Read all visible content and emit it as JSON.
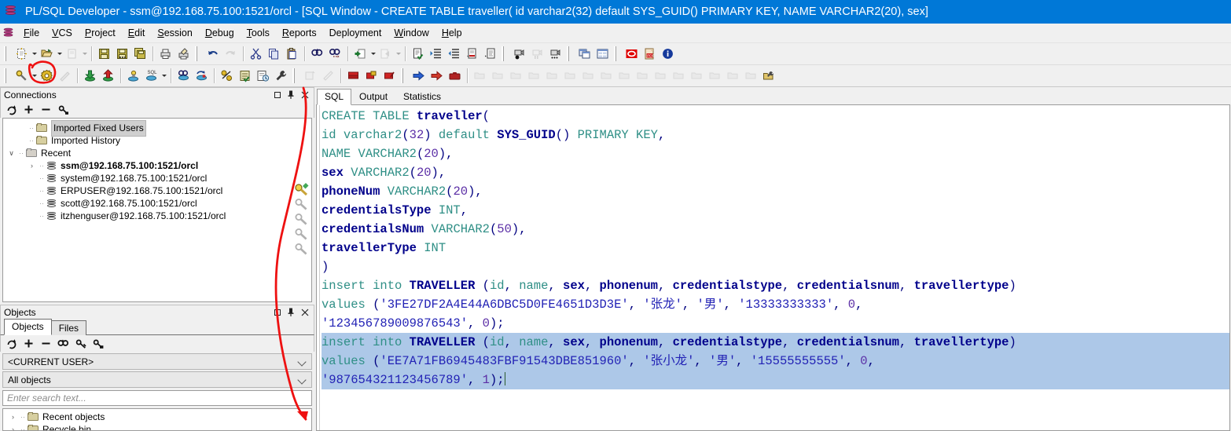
{
  "window": {
    "title": "PL/SQL Developer - ssm@192.168.75.100:1521/orcl - [SQL Window - CREATE TABLE traveller( id varchar2(32) default SYS_GUID() PRIMARY KEY, NAME VARCHAR2(20), sex]",
    "app_icon": "database-icon"
  },
  "menubar": {
    "items": [
      {
        "label": "File",
        "accel": "F"
      },
      {
        "label": "VCS",
        "accel": "V"
      },
      {
        "label": "Project",
        "accel": "P"
      },
      {
        "label": "Edit",
        "accel": "E"
      },
      {
        "label": "Session",
        "accel": "S"
      },
      {
        "label": "Debug",
        "accel": "D"
      },
      {
        "label": "Tools",
        "accel": "T"
      },
      {
        "label": "Reports",
        "accel": "R"
      },
      {
        "label": "Deployment",
        "accel": ""
      },
      {
        "label": "Window",
        "accel": "W"
      },
      {
        "label": "Help",
        "accel": "H"
      }
    ]
  },
  "toolbar_row1": {
    "items": [
      "new-document-icon",
      "new-dropdown",
      "open-folder-icon",
      "open-dropdown",
      "print-preview-icon",
      "print-dropdown",
      "save-icon",
      "save-as-icon",
      "save-all-icon",
      "print-icon",
      "print-setup-icon",
      "undo-icon",
      "redo-icon",
      "cut-icon",
      "copy-icon",
      "paste-icon",
      "find-icon",
      "find-next-icon",
      "previous-window-icon",
      "window-list-dropdown",
      "next-window-icon",
      "next-dropdown",
      "syntax-check-icon",
      "indent-icon",
      "outdent-icon",
      "comment-icon",
      "uncomment-icon",
      "record-macro-icon",
      "pause-macro-icon",
      "play-macro-icon",
      "cascade-windows-icon",
      "tile-windows-icon",
      "oracle-icon",
      "pdf-export-icon",
      "about-info-icon"
    ]
  },
  "toolbar_row2": {
    "items": [
      "explain-plan-icon",
      "explain-dropdown",
      "settings-gear-icon",
      "test-icon",
      "import-icon",
      "export-icon",
      "new-sql-window-icon",
      "sql-template-icon",
      "sql-dropdown",
      "commit-icon",
      "rollback-icon",
      "break-icon",
      "task-list-icon",
      "session-history-icon",
      "tools-wrench-icon",
      "step-into-icon",
      "step-over-icon",
      "breakpoint-icon",
      "breakpoint-add-icon",
      "breakpoint-clear-icon",
      "run-icon",
      "run-script-icon",
      "stop-icon",
      "obj-new-icon",
      "obj-edit-icon",
      "obj-back-icon",
      "obj-refresh-icon",
      "obj-forward-icon",
      "obj-props-icon",
      "obj-copy-icon",
      "obj-key-icon",
      "obj-find-icon",
      "obj-grant-icon",
      "obj-recompile-icon",
      "obj-drop-icon",
      "obj-rename-icon",
      "obj-view-icon",
      "obj-detail-icon",
      "obj-export-icon",
      "obj-settings-icon"
    ],
    "highlighted": "settings-gear-icon"
  },
  "connections_panel": {
    "title": "Connections",
    "window_buttons": [
      "restore-icon",
      "pin-icon",
      "close-icon"
    ],
    "toolbar": [
      "refresh-icon",
      "add-icon",
      "remove-icon",
      "edit-connection-icon"
    ],
    "tree": [
      {
        "label": "Imported Fixed Users",
        "type": "folder",
        "indent": 1,
        "expander": "",
        "selected": true,
        "bold": false
      },
      {
        "label": "Imported History",
        "type": "folder",
        "indent": 1,
        "expander": "",
        "selected": false,
        "bold": false
      },
      {
        "label": "Recent",
        "type": "folder-grey",
        "indent": 0,
        "expander": "expanded",
        "selected": false,
        "bold": false
      },
      {
        "label": "ssm@192.168.75.100:1521/orcl",
        "type": "db",
        "indent": 2,
        "expander": "collapsed",
        "selected": false,
        "bold": true
      },
      {
        "label": "system@192.168.75.100:1521/orcl",
        "type": "db",
        "indent": 2,
        "expander": "",
        "selected": false,
        "bold": false
      },
      {
        "label": "ERPUSER@192.168.75.100:1521/orcl",
        "type": "db",
        "indent": 2,
        "expander": "",
        "selected": false,
        "bold": false
      },
      {
        "label": "scott@192.168.75.100:1521/orcl",
        "type": "db",
        "indent": 2,
        "expander": "",
        "selected": false,
        "bold": false
      },
      {
        "label": "itzhenguser@192.168.75.100:1521/orcl",
        "type": "db",
        "indent": 2,
        "expander": "",
        "selected": false,
        "bold": false
      }
    ],
    "key_icons": [
      "key-active-icon",
      "key-icon",
      "key-icon",
      "key-icon",
      "key-icon"
    ]
  },
  "objects_panel": {
    "title": "Objects",
    "window_buttons": [
      "restore-icon",
      "pin-icon",
      "close-icon"
    ],
    "tabs": [
      {
        "label": "Objects",
        "active": true
      },
      {
        "label": "Files",
        "active": false
      }
    ],
    "toolbar": [
      "refresh-icon",
      "add-icon",
      "remove-icon",
      "find-icon",
      "filter-icon",
      "folder-filter-icon"
    ],
    "owner_select": "<CURRENT USER>",
    "type_select": "All objects",
    "search_placeholder": "Enter search text...",
    "tree": [
      {
        "label": "Recent objects",
        "expander": "collapsed"
      },
      {
        "label": "Recycle bin",
        "expander": "collapsed"
      }
    ]
  },
  "editor": {
    "tabs": [
      {
        "label": "SQL",
        "active": true
      },
      {
        "label": "Output",
        "active": false
      },
      {
        "label": "Statistics",
        "active": false
      }
    ],
    "lines": [
      {
        "highlighted": false,
        "tokens": [
          {
            "t": "CREATE",
            "c": "kw"
          },
          {
            "t": " ",
            "c": "pl"
          },
          {
            "t": "TABLE",
            "c": "kw"
          },
          {
            "t": " ",
            "c": "pl"
          },
          {
            "t": "traveller",
            "c": "id"
          },
          {
            "t": "(",
            "c": "pun"
          }
        ]
      },
      {
        "highlighted": false,
        "tokens": [
          {
            "t": "id varchar2",
            "c": "kw"
          },
          {
            "t": "(",
            "c": "pun"
          },
          {
            "t": "32",
            "c": "num"
          },
          {
            "t": ")",
            "c": "pun"
          },
          {
            "t": " default ",
            "c": "kw"
          },
          {
            "t": "SYS_GUID",
            "c": "id"
          },
          {
            "t": "()",
            "c": "pun"
          },
          {
            "t": " PRIMARY KEY",
            "c": "kw"
          },
          {
            "t": ",",
            "c": "pun"
          }
        ]
      },
      {
        "highlighted": false,
        "tokens": [
          {
            "t": "NAME",
            "c": "kw"
          },
          {
            "t": " VARCHAR2",
            "c": "kw"
          },
          {
            "t": "(",
            "c": "pun"
          },
          {
            "t": "20",
            "c": "num"
          },
          {
            "t": ")",
            "c": "pun"
          },
          {
            "t": ",",
            "c": "pun"
          }
        ]
      },
      {
        "highlighted": false,
        "tokens": [
          {
            "t": "sex",
            "c": "id"
          },
          {
            "t": " VARCHAR2",
            "c": "kw"
          },
          {
            "t": "(",
            "c": "pun"
          },
          {
            "t": "20",
            "c": "num"
          },
          {
            "t": ")",
            "c": "pun"
          },
          {
            "t": ",",
            "c": "pun"
          }
        ]
      },
      {
        "highlighted": false,
        "tokens": [
          {
            "t": "phoneNum",
            "c": "id"
          },
          {
            "t": " VARCHAR2",
            "c": "kw"
          },
          {
            "t": "(",
            "c": "pun"
          },
          {
            "t": "20",
            "c": "num"
          },
          {
            "t": ")",
            "c": "pun"
          },
          {
            "t": ",",
            "c": "pun"
          }
        ]
      },
      {
        "highlighted": false,
        "tokens": [
          {
            "t": "credentialsType",
            "c": "id"
          },
          {
            "t": " INT",
            "c": "kw"
          },
          {
            "t": ",",
            "c": "pun"
          }
        ]
      },
      {
        "highlighted": false,
        "tokens": [
          {
            "t": "credentialsNum",
            "c": "id"
          },
          {
            "t": " VARCHAR2",
            "c": "kw"
          },
          {
            "t": "(",
            "c": "pun"
          },
          {
            "t": "50",
            "c": "num"
          },
          {
            "t": ")",
            "c": "pun"
          },
          {
            "t": ",",
            "c": "pun"
          }
        ]
      },
      {
        "highlighted": false,
        "tokens": [
          {
            "t": "travellerType",
            "c": "id"
          },
          {
            "t": " INT",
            "c": "kw"
          }
        ]
      },
      {
        "highlighted": false,
        "tokens": [
          {
            "t": ")",
            "c": "pun"
          }
        ]
      },
      {
        "highlighted": false,
        "tokens": [
          {
            "t": "insert",
            "c": "kw"
          },
          {
            "t": " ",
            "c": "pl"
          },
          {
            "t": "into",
            "c": "kw"
          },
          {
            "t": " ",
            "c": "pl"
          },
          {
            "t": "TRAVELLER",
            "c": "id"
          },
          {
            "t": " (",
            "c": "pun"
          },
          {
            "t": "id",
            "c": "kw"
          },
          {
            "t": ", ",
            "c": "pun"
          },
          {
            "t": "name",
            "c": "kw"
          },
          {
            "t": ", ",
            "c": "pun"
          },
          {
            "t": "sex",
            "c": "id"
          },
          {
            "t": ", ",
            "c": "pun"
          },
          {
            "t": "phonenum",
            "c": "id"
          },
          {
            "t": ", ",
            "c": "pun"
          },
          {
            "t": "credentialstype",
            "c": "id"
          },
          {
            "t": ", ",
            "c": "pun"
          },
          {
            "t": "credentialsnum",
            "c": "id"
          },
          {
            "t": ", ",
            "c": "pun"
          },
          {
            "t": "travellertype",
            "c": "id"
          },
          {
            "t": ")",
            "c": "pun"
          }
        ]
      },
      {
        "highlighted": false,
        "tokens": [
          {
            "t": "values",
            "c": "kw"
          },
          {
            "t": " (",
            "c": "pun"
          },
          {
            "t": "'3FE27DF2A4E44A6DBC5D0FE4651D3D3E'",
            "c": "str"
          },
          {
            "t": ", ",
            "c": "pun"
          },
          {
            "t": "'张龙'",
            "c": "str"
          },
          {
            "t": ", ",
            "c": "pun"
          },
          {
            "t": "'男'",
            "c": "str"
          },
          {
            "t": ", ",
            "c": "pun"
          },
          {
            "t": "'13333333333'",
            "c": "str"
          },
          {
            "t": ", ",
            "c": "pun"
          },
          {
            "t": "0",
            "c": "num"
          },
          {
            "t": ",",
            "c": "pun"
          }
        ]
      },
      {
        "highlighted": false,
        "tokens": [
          {
            "t": "'123456789009876543'",
            "c": "str"
          },
          {
            "t": ", ",
            "c": "pun"
          },
          {
            "t": "0",
            "c": "num"
          },
          {
            "t": ");",
            "c": "pun"
          }
        ]
      },
      {
        "highlighted": true,
        "tokens": [
          {
            "t": "insert",
            "c": "kw"
          },
          {
            "t": " ",
            "c": "pl"
          },
          {
            "t": "into",
            "c": "kw"
          },
          {
            "t": " ",
            "c": "pl"
          },
          {
            "t": "TRAVELLER",
            "c": "id"
          },
          {
            "t": " (",
            "c": "pun"
          },
          {
            "t": "id",
            "c": "kw"
          },
          {
            "t": ", ",
            "c": "pun"
          },
          {
            "t": "name",
            "c": "kw"
          },
          {
            "t": ", ",
            "c": "pun"
          },
          {
            "t": "sex",
            "c": "id"
          },
          {
            "t": ", ",
            "c": "pun"
          },
          {
            "t": "phonenum",
            "c": "id"
          },
          {
            "t": ", ",
            "c": "pun"
          },
          {
            "t": "credentialstype",
            "c": "id"
          },
          {
            "t": ", ",
            "c": "pun"
          },
          {
            "t": "credentialsnum",
            "c": "id"
          },
          {
            "t": ", ",
            "c": "pun"
          },
          {
            "t": "travellertype",
            "c": "id"
          },
          {
            "t": ")",
            "c": "pun"
          }
        ]
      },
      {
        "highlighted": true,
        "tokens": [
          {
            "t": "values",
            "c": "kw"
          },
          {
            "t": " (",
            "c": "pun"
          },
          {
            "t": "'EE7A71FB6945483FBF91543DBE851960'",
            "c": "str"
          },
          {
            "t": ", ",
            "c": "pun"
          },
          {
            "t": "'张小龙'",
            "c": "str"
          },
          {
            "t": ", ",
            "c": "pun"
          },
          {
            "t": "'男'",
            "c": "str"
          },
          {
            "t": ", ",
            "c": "pun"
          },
          {
            "t": "'15555555555'",
            "c": "str"
          },
          {
            "t": ", ",
            "c": "pun"
          },
          {
            "t": "0",
            "c": "num"
          },
          {
            "t": ",",
            "c": "pun"
          }
        ]
      },
      {
        "highlighted": true,
        "caret": true,
        "tokens": [
          {
            "t": "'987654321123456789'",
            "c": "str"
          },
          {
            "t": ", ",
            "c": "pun"
          },
          {
            "t": "1",
            "c": "num"
          },
          {
            "t": ");",
            "c": "pun"
          }
        ]
      }
    ]
  },
  "annotations": {
    "color": "#ee1111",
    "shapes": [
      "circle-around-settings-gear",
      "curved-arrow-to-objects-tree"
    ]
  },
  "colors": {
    "title_bar": "#0078d7",
    "chrome": "#f0f0f0",
    "editor_bg": "#ffffff",
    "selection": "#adc8e8",
    "keyword": "#2f8f86",
    "identifier": "#00008b",
    "number": "#5b2ea6",
    "string": "#2222b5",
    "annotation": "#ee1111"
  }
}
